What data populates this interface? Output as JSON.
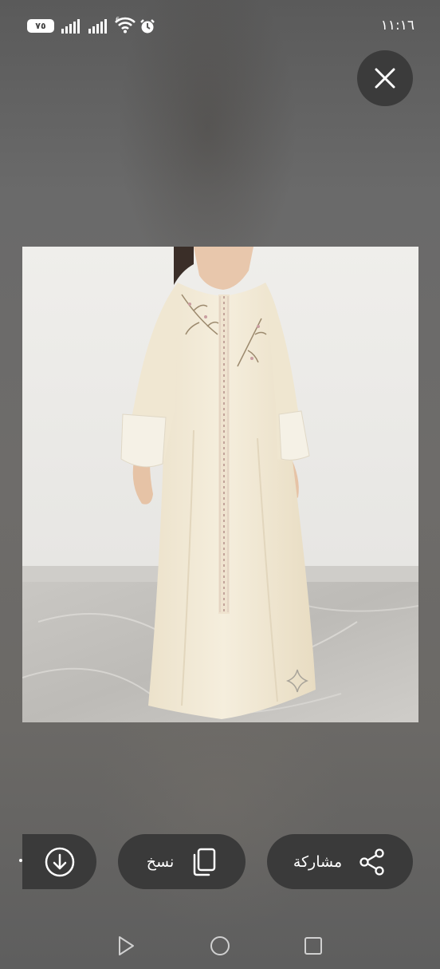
{
  "status_bar": {
    "battery": "٧٥",
    "time": "١١:١٦"
  },
  "viewer": {
    "close_icon": "close-icon",
    "image_subject": "cream embroidered abaya dress"
  },
  "actions": {
    "download_icon": "download-icon",
    "copy_label": "نسخ",
    "copy_icon": "copy-icon",
    "share_label": "مشاركة",
    "share_icon": "share-icon"
  },
  "navigation": {
    "back_icon": "back-triangle-icon",
    "home_icon": "home-circle-icon",
    "recents_icon": "recents-square-icon"
  },
  "colors": {
    "pill_background": "#3a3a3a",
    "dress": "#f1e9d6",
    "wall": "#ecebe8"
  }
}
